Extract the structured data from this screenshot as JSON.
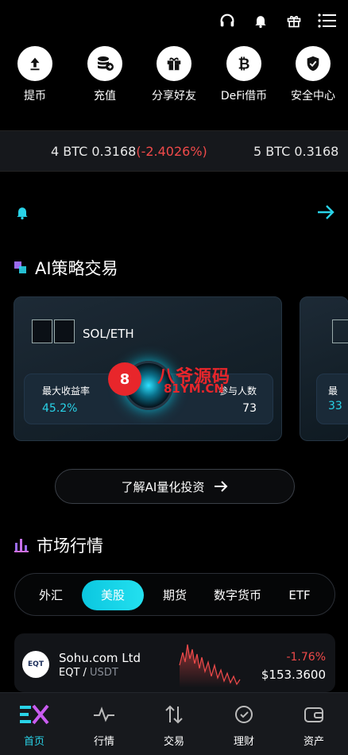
{
  "header": {
    "icons": [
      "headset-icon",
      "bell-icon",
      "gift-icon",
      "menu-icon"
    ]
  },
  "quick_actions": [
    {
      "label": "提币",
      "icon": "withdraw-icon"
    },
    {
      "label": "充值",
      "icon": "deposit-icon"
    },
    {
      "label": "分享好友",
      "icon": "gift-icon"
    },
    {
      "label": "DeFi借币",
      "icon": "bitcoin-icon"
    },
    {
      "label": "安全中心",
      "icon": "shield-icon"
    }
  ],
  "ticker": {
    "item1_prefix": "4 BTC 0.3168",
    "item1_change": "(-2.4026%)",
    "item2_prefix": "5 BTC 0.3168"
  },
  "ai_section": {
    "title": "AI策略交易",
    "cards": [
      {
        "pair": "SOL/ETH",
        "label_left": "最大收益率",
        "value_left": "45.2%",
        "label_right": "参与人数",
        "value_right": "73"
      },
      {
        "label_left": "最",
        "value_left": "33"
      }
    ],
    "learn_button": "了解AI量化投资"
  },
  "watermark": {
    "logo": "8",
    "text1": "八爷源码",
    "text2": "81YM.CN"
  },
  "market": {
    "title": "市场行情",
    "tabs": [
      "外汇",
      "美股",
      "期货",
      "数字货币",
      "ETF"
    ],
    "active_tab": "美股",
    "rows": [
      {
        "logo": "EQT",
        "name": "Sohu.com Ltd",
        "symbol": "EQT",
        "quote": "USDT",
        "change": "-1.76%",
        "price": "$153.3600"
      }
    ]
  },
  "bottom_nav": [
    {
      "label": "首页",
      "icon": "home-logo-icon",
      "active": true
    },
    {
      "label": "行情",
      "icon": "pulse-icon",
      "active": false
    },
    {
      "label": "交易",
      "icon": "swap-icon",
      "active": false
    },
    {
      "label": "理财",
      "icon": "finance-icon",
      "active": false
    },
    {
      "label": "资产",
      "icon": "wallet-icon",
      "active": false
    }
  ],
  "colors": {
    "accent": "#29d3e8",
    "negative": "#f04a4a",
    "background": "#000000"
  }
}
